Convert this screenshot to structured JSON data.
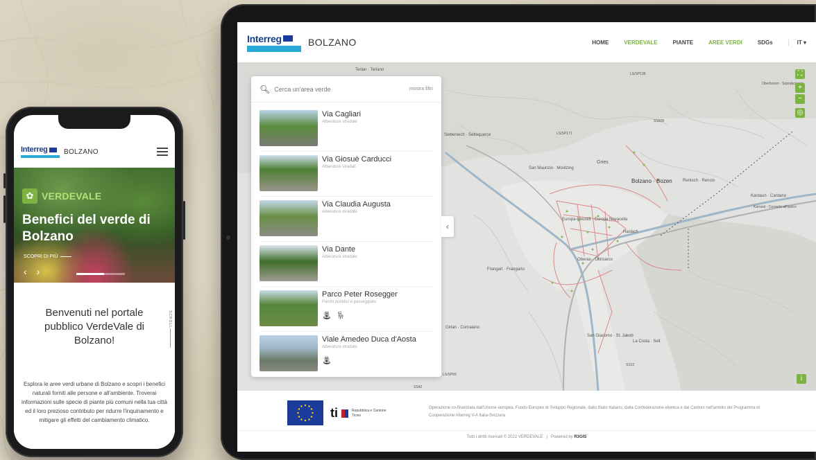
{
  "phone": {
    "logo": "Interreg",
    "city": "BOLZANO",
    "hero": {
      "brand": "VERDEVALE",
      "title": "Benefici del verde di Bolzano",
      "link": "SCOPRI DI PIÙ"
    },
    "welcome": {
      "title": "Benvenuti nel portale pubblico VerdeVale di Bolzano!",
      "scroll_label": "SCROLL",
      "body": "Esplora le aree verdi urbane di Bolzano e scopri i benefici naturali forniti alle persone e all'ambiente. Troverai informazioni sulle specie di piante più comuni nella tua città ed il loro prezioso contributo per ridurre l'inquinamento e mitigare gli effetti del cambiamento climatico."
    }
  },
  "tablet": {
    "logo": "Interreg",
    "city": "BOLZANO",
    "nav": [
      "HOME",
      "VERDEVALE",
      "PIANTE",
      "AREE VERDI",
      "SDGs",
      "IT ▾"
    ],
    "search": {
      "placeholder": "Cerca un'area verde",
      "filters": "mostra filtri"
    },
    "items": [
      {
        "name": "Via Cagliari",
        "category": "Alberature stradale",
        "icons": []
      },
      {
        "name": "Via Giosuè Carducci",
        "category": "Alberature stradali",
        "icons": []
      },
      {
        "name": "Via Claudia Augusta",
        "category": "Alberature stradale",
        "icons": []
      },
      {
        "name": "Via Dante",
        "category": "Alberature stradale",
        "icons": []
      },
      {
        "name": "Parco Peter Rosegger",
        "category": "Parchi pubblici e passeggiate",
        "icons": [
          "fountain-icon",
          "bench-icon"
        ]
      },
      {
        "name": "Viale Amedeo Duca d'Aosta",
        "category": "Alberature stradale",
        "icons": [
          "fountain-icon"
        ]
      }
    ],
    "map_labels": [
      "Terlan · Terlano",
      "LS/SP136",
      "Siebeneich · Settequerce",
      "LS/SP171",
      "SS508",
      "San Maurizio · Moritzing",
      "Gries",
      "Bolzano · Bozen",
      "Rentsch · Rencio",
      "Kardaun · Cardano",
      "Europa-Neustift · Europa Novacella",
      "Haslach",
      "Frangart · Frangarto",
      "Oberau · Oltrisarco",
      "Girlan · Cornaiano",
      "San Giacomo · St. Jakob",
      "La Costa · Seit",
      "LS/SP55",
      "SS42",
      "SS12",
      "Karneid · Cornedo all'Isarco",
      "Oberbozen · Soprabolzano"
    ],
    "footer": {
      "region": "Repubblica e Cantone Ticino",
      "text": "Operazione co-finanziata dall'Unione europea, Fondo Europeo di Sviluppo Regionale, dallo Stato Italiano, dalla Confederazione elvetica e dai Cantoni nell'ambito del Programma di Cooperazione Interreg V-A Italia-Svizzera",
      "copyright": "Tutti i diritti riservati © 2022 VERDEVALE",
      "powered": "Powered by",
      "powered_brand": "R3GIS"
    }
  },
  "colors": {
    "accent_green": "#7cb342",
    "interreg_blue": "#173f8a",
    "cyan_bar": "#29a9d6"
  }
}
